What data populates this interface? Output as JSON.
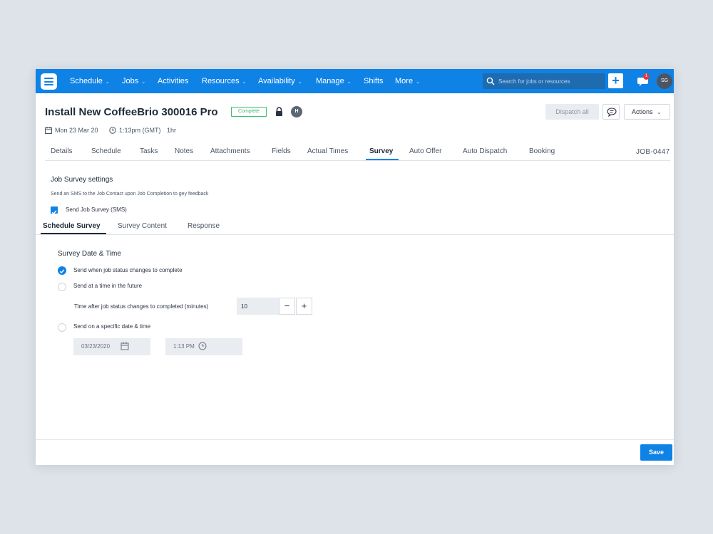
{
  "nav": {
    "items": [
      {
        "label": "Schedule",
        "caret": "⌄"
      },
      {
        "label": "Jobs",
        "caret": "⌄"
      },
      {
        "label": "Activities",
        "caret": ""
      },
      {
        "label": "Resources",
        "caret": "⌄"
      },
      {
        "label": "Availability",
        "caret": "⌄"
      },
      {
        "label": "Manage",
        "caret": "⌄"
      },
      {
        "label": "Shifts",
        "caret": ""
      },
      {
        "label": "More",
        "caret": "⌄"
      }
    ],
    "search_placeholder": "Search for jobs or resources",
    "notification_count": "1",
    "user_initials": "SG",
    "accent_color": "#0f82e6"
  },
  "job": {
    "title": "Install New CoffeeBrio 300016 Pro",
    "status": "Complete",
    "status_color": "#3dbb6e",
    "assignee_initial": "H",
    "date": "Mon 23 Mar 20",
    "time": "1:13pm (GMT)",
    "duration": "1hr",
    "id": "JOB-0447"
  },
  "header_buttons": {
    "dispatch": "Dispatch all",
    "actions": "Actions"
  },
  "tabs": [
    "Details",
    "Schedule",
    "Tasks",
    "Notes",
    "Attachments",
    "Fields",
    "Actual Times",
    "Survey",
    "Auto Offer",
    "Auto Dispatch",
    "Booking"
  ],
  "active_tab": "Survey",
  "survey": {
    "title": "Job Survey settings",
    "description": "Send an SMS to the Job Contact upon Job Completion to gey feedback",
    "checkbox_label": "Send Job Survey (SMS)",
    "checkbox_checked": true,
    "subtabs": [
      "Schedule Survey",
      "Survey Content",
      "Response"
    ],
    "active_subtab": "Schedule Survey",
    "group_title": "Survey Date & Time",
    "options": [
      {
        "label": "Send when job status changes to complete",
        "checked": true
      },
      {
        "label": "Send at a time in the future",
        "checked": false
      },
      {
        "label": "Send on a specific date & time",
        "checked": false
      }
    ],
    "minutes_label": "Time after job status changes to completed (minutes)",
    "minutes_value": "10",
    "date_value": "03/23/2020",
    "time_value": "1:13 PM"
  },
  "footer": {
    "save": "Save"
  }
}
